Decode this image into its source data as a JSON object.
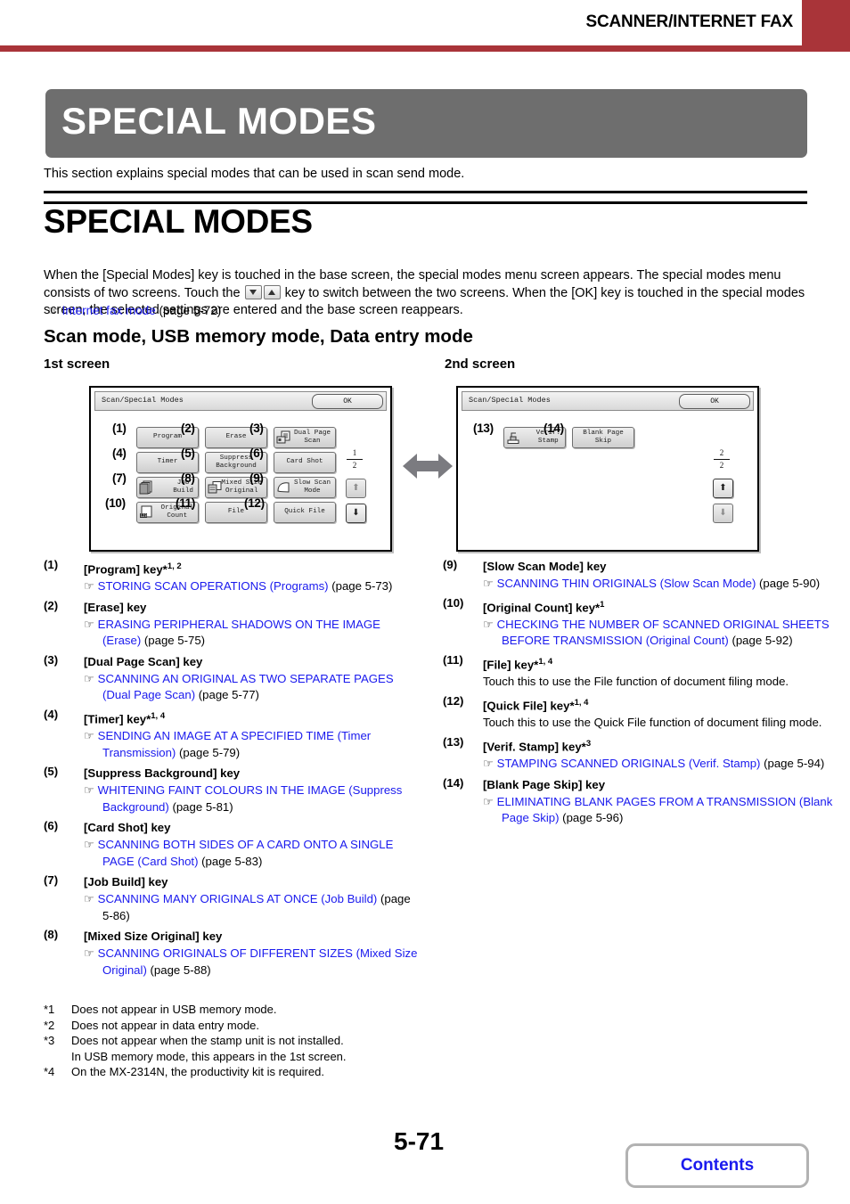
{
  "header": {
    "title": "SCANNER/INTERNET FAX",
    "accent_color": "#a93439"
  },
  "banner": {
    "title": "SPECIAL MODES",
    "background_color": "#6e6e6e"
  },
  "intro": "This section explains special modes that can be used in scan send mode.",
  "section": {
    "heading": "SPECIAL MODES",
    "paragraph_a": "When the [Special Modes] key is touched in the base screen, the special modes menu screen appears. The special modes menu consists of two screens. Touch the ",
    "paragraph_b": " key to switch between the two screens. When the [OK] key is touched in the special modes screen, the selected settings are entered and the base screen reappears.",
    "xref_link": "Internet fax mode",
    "xref_page": "(page 5-72)"
  },
  "subsection": {
    "heading": "Scan mode, USB memory mode, Data entry mode",
    "screen1_label": "1st screen",
    "screen2_label": "2nd screen"
  },
  "panel1": {
    "titlebar": "Scan/Special Modes",
    "ok_label": "OK",
    "page_current": "1",
    "page_total": "2",
    "keys": [
      {
        "callout": "(1)",
        "label": "Program",
        "icon": ""
      },
      {
        "callout": "(2)",
        "label": "Erase",
        "icon": ""
      },
      {
        "callout": "(3)",
        "label": "Dual Page\nScan",
        "icon": "dual-page-scan-icon"
      },
      {
        "callout": "(4)",
        "label": "Timer",
        "icon": ""
      },
      {
        "callout": "(5)",
        "label": "Suppress\nBackground",
        "icon": ""
      },
      {
        "callout": "(6)",
        "label": "Card Shot",
        "icon": ""
      },
      {
        "callout": "(7)",
        "label": "Job\nBuild",
        "icon": "job-build-icon"
      },
      {
        "callout": "(8)",
        "label": "Mixed Size\nOriginal",
        "icon": "mixed-size-original-icon"
      },
      {
        "callout": "(9)",
        "label": "Slow Scan\nMode",
        "icon": "slow-scan-mode-icon"
      },
      {
        "callout": "(10)",
        "label": "Original\nCount",
        "icon": "original-count-icon"
      },
      {
        "callout": "(11)",
        "label": "File",
        "icon": ""
      },
      {
        "callout": "(12)",
        "label": "Quick File",
        "icon": ""
      }
    ]
  },
  "panel2": {
    "titlebar": "Scan/Special Modes",
    "ok_label": "OK",
    "page_current": "2",
    "page_total": "2",
    "keys": [
      {
        "callout": "(13)",
        "label": "Verif.\nStamp",
        "icon": "verif-stamp-icon"
      },
      {
        "callout": "(14)",
        "label": "Blank Page\nSkip",
        "icon": ""
      }
    ]
  },
  "link_color": "#1a1aee",
  "list_left": [
    {
      "num": "(1)",
      "key": "[Program] key*",
      "sup": "1, 2",
      "ref_link": "STORING SCAN OPERATIONS (Programs)",
      "ref_page": "(page 5-73)",
      "text": ""
    },
    {
      "num": "(2)",
      "key": "[Erase] key",
      "sup": "",
      "ref_link": "ERASING PERIPHERAL SHADOWS ON THE IMAGE (Erase)",
      "ref_page": "(page 5-75)",
      "text": ""
    },
    {
      "num": "(3)",
      "key": "[Dual Page Scan] key",
      "sup": "",
      "ref_link": "SCANNING AN ORIGINAL AS TWO SEPARATE PAGES (Dual Page Scan)",
      "ref_page": "(page 5-77)",
      "text": ""
    },
    {
      "num": "(4)",
      "key": "[Timer] key*",
      "sup": "1, 4",
      "ref_link": "SENDING AN IMAGE AT A SPECIFIED TIME (Timer Transmission)",
      "ref_page": "(page 5-79)",
      "text": ""
    },
    {
      "num": "(5)",
      "key": "[Suppress Background] key",
      "sup": "",
      "ref_link": "WHITENING FAINT COLOURS IN THE IMAGE (Suppress Background)",
      "ref_page": "(page 5-81)",
      "text": ""
    },
    {
      "num": "(6)",
      "key": "[Card Shot] key",
      "sup": "",
      "ref_link": "SCANNING BOTH SIDES OF A CARD ONTO A SINGLE PAGE (Card Shot)",
      "ref_page": "(page 5-83)",
      "text": ""
    },
    {
      "num": "(7)",
      "key": "[Job Build] key",
      "sup": "",
      "ref_link": "SCANNING MANY ORIGINALS AT ONCE (Job Build)",
      "ref_page": "(page 5-86)",
      "text": ""
    },
    {
      "num": "(8)",
      "key": "[Mixed Size Original] key",
      "sup": "",
      "ref_link": "SCANNING ORIGINALS OF DIFFERENT SIZES (Mixed Size Original)",
      "ref_page": "(page 5-88)",
      "text": ""
    }
  ],
  "list_right": [
    {
      "num": "(9)",
      "key": "[Slow Scan Mode] key",
      "sup": "",
      "ref_link": "SCANNING THIN ORIGINALS (Slow Scan Mode)",
      "ref_page": "(page 5-90)",
      "text": ""
    },
    {
      "num": "(10)",
      "key": "[Original Count] key*",
      "sup": "1",
      "ref_link": "CHECKING THE NUMBER OF SCANNED ORIGINAL SHEETS BEFORE TRANSMISSION (Original Count)",
      "ref_page": "(page 5-92)",
      "text": ""
    },
    {
      "num": "(11)",
      "key": "[File] key*",
      "sup": "1, 4",
      "ref_link": "",
      "ref_page": "",
      "text": "Touch this to use the File function of document filing mode."
    },
    {
      "num": "(12)",
      "key": "[Quick File] key*",
      "sup": "1, 4",
      "ref_link": "",
      "ref_page": "",
      "text": "Touch this to use the Quick File function of document filing mode."
    },
    {
      "num": "(13)",
      "key": "[Verif. Stamp] key*",
      "sup": "3",
      "ref_link": "STAMPING SCANNED ORIGINALS (Verif. Stamp)",
      "ref_page": "(page 5-94)",
      "text": ""
    },
    {
      "num": "(14)",
      "key": "[Blank Page Skip] key",
      "sup": "",
      "ref_link": "ELIMINATING BLANK PAGES FROM A TRANSMISSION (Blank Page Skip)",
      "ref_page": "(page 5-96)",
      "text": ""
    }
  ],
  "footnotes": [
    {
      "mark": "*1",
      "text": "Does not appear in USB memory mode.",
      "cont": ""
    },
    {
      "mark": "*2",
      "text": "Does not appear in data entry mode.",
      "cont": ""
    },
    {
      "mark": "*3",
      "text": "Does not appear when the stamp unit is not installed.",
      "cont": "In USB memory mode, this appears in the 1st screen."
    },
    {
      "mark": "*4",
      "text": "On the MX-2314N, the productivity kit is required.",
      "cont": ""
    }
  ],
  "footer": {
    "page_number": "5-71",
    "contents_label": "Contents"
  }
}
